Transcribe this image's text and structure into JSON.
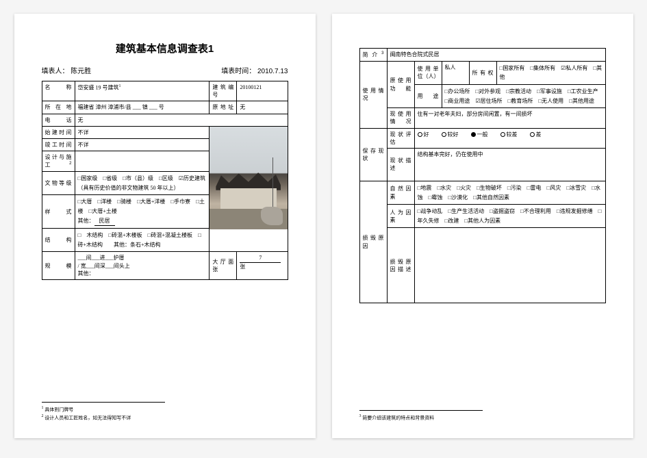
{
  "page1": {
    "title": "建筑基本信息调查表1",
    "filler_label": "填表人：",
    "filler_value": "陈元胜",
    "filltime_label": "填表时间：",
    "filltime_value": "2010.7.13",
    "name_label": "名称",
    "name_value": "岱安盛 19 号建筑",
    "sup1": "1",
    "bno_label": "建筑编号",
    "bno_value": "20100121",
    "location_label": "所在地",
    "location_value": "福建省 漳州 漳浦市/县 ___ 镇 ___ 号",
    "orig_addr_label": "原地址",
    "orig_addr_value": "无",
    "phone_label": "电话",
    "phone_value": "无",
    "build_time_label": "始建时间",
    "build_time_value": "不详",
    "finish_time_label": "竣工时间",
    "finish_time_value": "不详",
    "designer_label": "设计与施工",
    "sup2": "2",
    "designer_value": "",
    "heritage_label": "文物等级",
    "heritage_opts": "□国家级　□省级　□市（县）级　□区级　☑历史建筑（具有历史价值的非文物建筑 50 年以上）",
    "style_label": "样式",
    "style_opts": "□大厝　□洋楼　□骑楼　□大厝+洋楼　□手巾寮　□土楼　□大厝+土楼",
    "style_other_prefix": "其他：",
    "style_other_value": "民居",
    "struct_label": "结构",
    "struct_opts": "□　木结构　□砖混+木楼板　□砖混+混凝土楼板　□砖+木结构　　其他：条石+木结构",
    "scale_label": "规模",
    "scale_line1_prefix": "___间___进___护厝",
    "scale_line2_prefix": "/ 宽___间深___间头上",
    "scale_line3": "其他：",
    "hall_label": "大厅面张",
    "hall_value": "7",
    "hall_suffix": "张",
    "fn1": "具体到门牌号",
    "fn2": "设计人员和工匠姓名，如无法得知写不详"
  },
  "page2": {
    "intro_label": "简介",
    "sup3": "3",
    "intro_value": "闽南特色合院式民居",
    "usage_label": "使用情况",
    "orig_func_label": "原使用功能",
    "unit_label": "使用单位（人）",
    "unit_value": "私人",
    "owner_label": "所有权",
    "owner_opts": "□国家所有　□集体所有　☑私人所有　□其他",
    "use_label": "用途",
    "use_opts": "□办公场所　□对外参观　□宗教活动　□军事设施　□工农业生产　□商业用途　☑居住场所　□教育场所　□无人使用　□其他用途",
    "curr_func_label": "现使用情况",
    "curr_func_value": "住有一对老年夫妇，部分房间闲置，有一间损坏",
    "preserve_label": "保存现状",
    "rate_label": "现状评估",
    "rate_good": "○好",
    "rate_ok": "○较好",
    "rate_mid": "●一般",
    "rate_poor": "○较差",
    "rate_bad": "○差",
    "desc_label": "现状描述",
    "desc_value": "结构基本完好，仍在使用中",
    "damage_label": "损毁原因",
    "nat_label": "自然因素",
    "nat_opts": "□地震　□水灾　□火灾　□生物破坏　□污染　□雷电　□风灾　□冰雪灾　□水蚀　□霉蚀　□沙漠化　□其他自然因素",
    "hum_label": "人为因素",
    "hum_opts": "□战争动乱　□生产生活活动　□盗掘盗窃　□不合理利用　□违规发掘修缮　□年久失修　□改建　□其他人为因素",
    "reason_desc_label": "损毁原因描述",
    "reason_desc_value": "",
    "fn3": "简要介绍该建筑的特点和背景资料"
  }
}
